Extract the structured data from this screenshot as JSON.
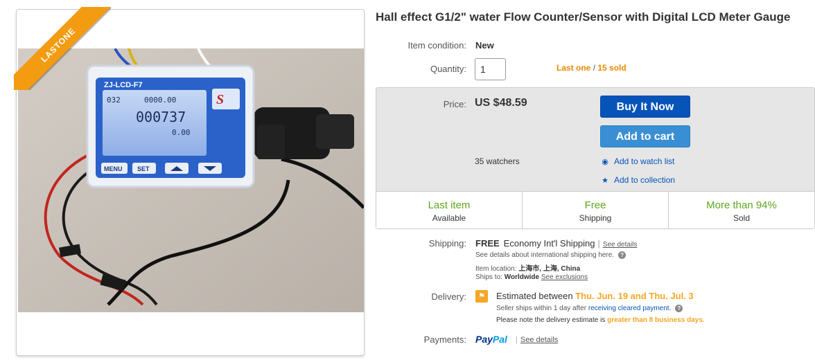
{
  "listing": {
    "title": "Hall effect G1/2\" water Flow Counter/Sensor with Digital LCD Meter Gauge",
    "ribbon": "LASTONE",
    "photo": {
      "device_model": "ZJ-LCD-F7",
      "lcd_top_left": "032",
      "lcd_top_right": "0000.00",
      "lcd_main": "000737",
      "lcd_rate": "0.00",
      "buttons": [
        "MENU",
        "SET",
        "",
        ""
      ]
    }
  },
  "condition": {
    "label": "Item condition:",
    "value": "New"
  },
  "quantity": {
    "label": "Quantity:",
    "value": "1",
    "last_one": "Last one",
    "slash": "/",
    "sold": "15 sold"
  },
  "price": {
    "label": "Price:",
    "value": "US $48.59",
    "buy_now": "Buy It Now",
    "add_to_cart": "Add to cart",
    "watchers": "35 watchers",
    "watch_list": "Add to watch list",
    "collection": "Add to collection"
  },
  "stats": [
    {
      "main": "Last item",
      "sub": "Available"
    },
    {
      "main": "Free",
      "sub": "Shipping"
    },
    {
      "main": "More than 94%",
      "sub": "Sold"
    }
  ],
  "shipping": {
    "label": "Shipping:",
    "free": "FREE",
    "method": "Economy Int'l Shipping",
    "see_details": "See details",
    "intl_note": "See details about international shipping here.",
    "location_label": "Item location:",
    "location": "上海市, 上海, China",
    "ships_to_label": "Ships to:",
    "ships_to": "Worldwide",
    "see_exclusions": "See exclusions"
  },
  "delivery": {
    "label": "Delivery:",
    "estimated_prefix": "Estimated between",
    "dates": "Thu. Jun. 19 and Thu. Jul. 3",
    "seller_note": "Seller ships within 1 day after",
    "cleared_payment": "receiving cleared payment.",
    "note_prefix": "Please note the delivery estimate is",
    "note_highlight": "greater than 8 business days."
  },
  "payments": {
    "label": "Payments:",
    "paypal_a": "Pay",
    "paypal_b": "Pal",
    "see_details": "See details"
  },
  "colors": {
    "accent_blue": "#0654ba",
    "cart_blue": "#3a8fd4",
    "green": "#5ba71b",
    "orange": "#f5a623"
  }
}
